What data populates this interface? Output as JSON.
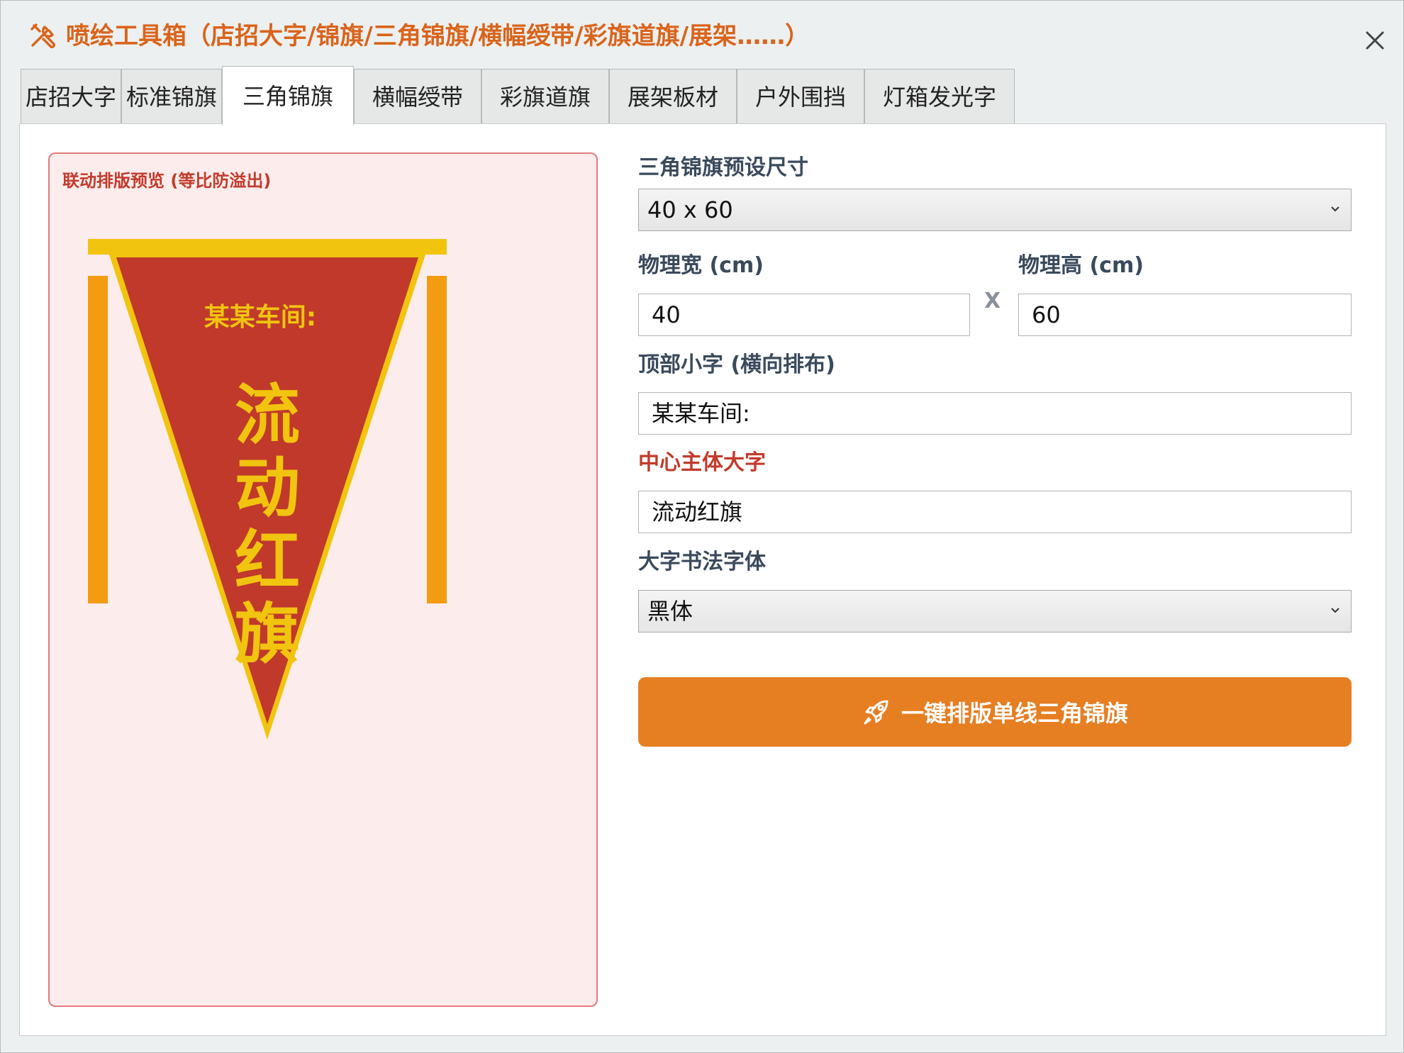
{
  "window": {
    "title": "喷绘工具箱（店招大字/锦旗/三角锦旗/横幅绶带/彩旗道旗/展架……）",
    "accent_color": "#d9641b"
  },
  "tabs": [
    {
      "label": "店招大字",
      "active": false
    },
    {
      "label": "标准锦旗",
      "active": false
    },
    {
      "label": "三角锦旗",
      "active": true
    },
    {
      "label": "横幅绶带",
      "active": false
    },
    {
      "label": "彩旗道旗",
      "active": false
    },
    {
      "label": "展架板材",
      "active": false
    },
    {
      "label": "户外围挡",
      "active": false
    },
    {
      "label": "灯箱发光字",
      "active": false
    }
  ],
  "preview": {
    "label": "联动排版预览 (等比防溢出)",
    "top_text": "某某车间:",
    "main_chars": [
      "流",
      "动",
      "红",
      "旗"
    ],
    "colors": {
      "flag": "#c0392b",
      "border": "#f1c40f",
      "text": "#f1c40f",
      "pole": "#f39c12"
    }
  },
  "form": {
    "preset": {
      "label": "三角锦旗预设尺寸",
      "value": "40 x 60"
    },
    "width": {
      "label": "物理宽 (cm)",
      "value": "40"
    },
    "times_sign": "X",
    "height": {
      "label": "物理高 (cm)",
      "value": "60"
    },
    "top_text": {
      "label": "顶部小字 (横向排布)",
      "value": "某某车间:"
    },
    "main_text": {
      "label": "中心主体大字",
      "value": "流动红旗"
    },
    "font": {
      "label": "大字书法字体",
      "value": "黑体"
    },
    "action_button": {
      "label": "一键排版单线三角锦旗",
      "color": "#e67e22"
    }
  },
  "icons": {
    "title": "tools-icon",
    "close": "close-icon",
    "dropdown": "chevron-down-icon",
    "action": "rocket-icon"
  }
}
